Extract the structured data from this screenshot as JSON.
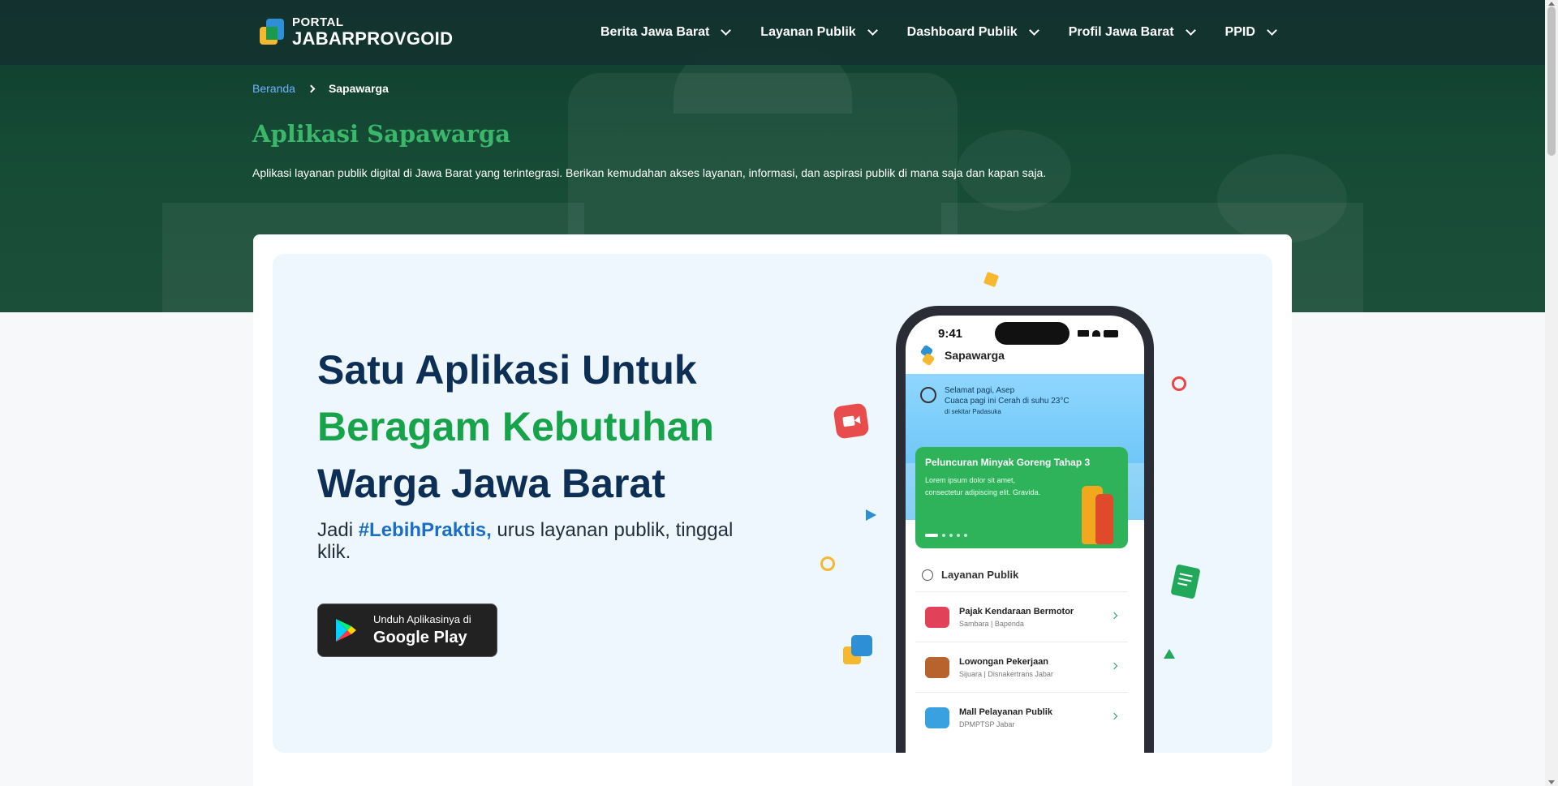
{
  "logo": {
    "line1": "PORTAL",
    "line2": "JABARPROVGOID"
  },
  "nav": [
    {
      "label": "Berita Jawa Barat"
    },
    {
      "label": "Layanan Publik"
    },
    {
      "label": "Dashboard Publik"
    },
    {
      "label": "Profil Jawa Barat"
    },
    {
      "label": "PPID"
    }
  ],
  "breadcrumb": {
    "home": "Beranda",
    "current": "Sapawarga"
  },
  "page": {
    "title": "Aplikasi Sapawarga",
    "subtitle": "Aplikasi layanan publik digital di Jawa Barat yang terintegrasi. Berikan kemudahan akses layanan, informasi, dan aspirasi publik di mana saja dan kapan saja."
  },
  "promo": {
    "headline_line1": "Satu Aplikasi Untuk",
    "headline_line2": "Beragam Kebutuhan",
    "headline_line3": "Warga Jawa Barat",
    "tagline_prefix": "Jadi ",
    "tagline_hashtag": "#LebihPraktis,",
    "tagline_suffix": " urus layanan publik, tinggal klik.",
    "store_small": "Unduh Aplikasinya di",
    "store_big": "Google Play"
  },
  "phone": {
    "time": "9:41",
    "app_name": "Sapawarga",
    "greeting": "Selamat pagi, Asep",
    "weather": "Cuaca pagi ini Cerah di suhu 23°C",
    "location": "di sekitar Padasuka",
    "banner_title": "Peluncuran Minyak Goreng Tahap 3",
    "banner_text": "Lorem ipsum dolor sit amet, consectetur adipiscing elit. Gravida.",
    "services_title": "Layanan Publik",
    "services": [
      {
        "title": "Pajak Kendaraan Bermotor",
        "subtitle": "Sambara | Bapenda",
        "icon": "car-icon"
      },
      {
        "title": "Lowongan Pekerjaan",
        "subtitle": "Sijuara | Disnakertrans Jabar",
        "icon": "briefcase-icon"
      },
      {
        "title": "Mall Pelayanan Publik",
        "subtitle": "DPMPTSP Jabar",
        "icon": "building-icon"
      }
    ]
  },
  "colors": {
    "accent_green": "#16a34a",
    "title_green": "#3ab76a",
    "navy": "#0e2f55",
    "link_blue": "#1a6ec6"
  }
}
